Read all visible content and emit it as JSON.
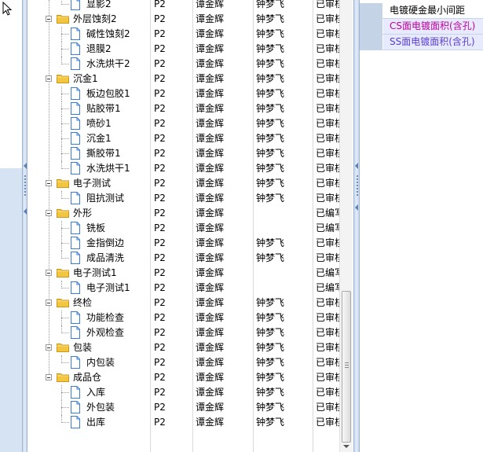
{
  "tree": {
    "rows": [
      {
        "level": 2,
        "type": "doc",
        "name": "显影2",
        "code": "P2",
        "person_a": "谭金辉",
        "person_b": "钟梦飞",
        "status": "已审核"
      },
      {
        "level": 1,
        "type": "folder",
        "name": "外层蚀刻2",
        "code": "P2",
        "person_a": "谭金辉",
        "person_b": "钟梦飞",
        "status": "已审核"
      },
      {
        "level": 2,
        "type": "doc",
        "name": "碱性蚀刻2",
        "code": "P2",
        "person_a": "谭金辉",
        "person_b": "钟梦飞",
        "status": "已审核"
      },
      {
        "level": 2,
        "type": "doc",
        "name": "退膜2",
        "code": "P2",
        "person_a": "谭金辉",
        "person_b": "钟梦飞",
        "status": "已审核"
      },
      {
        "level": 2,
        "type": "doc",
        "name": "水洗烘干2",
        "code": "P2",
        "person_a": "谭金辉",
        "person_b": "钟梦飞",
        "status": "已审核"
      },
      {
        "level": 1,
        "type": "folder",
        "name": "沉金1",
        "code": "P2",
        "person_a": "谭金辉",
        "person_b": "钟梦飞",
        "status": "已审核"
      },
      {
        "level": 2,
        "type": "doc",
        "name": "板边包胶1",
        "code": "P2",
        "person_a": "谭金辉",
        "person_b": "钟梦飞",
        "status": "已审核"
      },
      {
        "level": 2,
        "type": "doc",
        "name": "贴胶带1",
        "code": "P2",
        "person_a": "谭金辉",
        "person_b": "钟梦飞",
        "status": "已审核"
      },
      {
        "level": 2,
        "type": "doc",
        "name": "喷砂1",
        "code": "P2",
        "person_a": "谭金辉",
        "person_b": "钟梦飞",
        "status": "已审核"
      },
      {
        "level": 2,
        "type": "doc",
        "name": "沉金1",
        "code": "P2",
        "person_a": "谭金辉",
        "person_b": "钟梦飞",
        "status": "已审核"
      },
      {
        "level": 2,
        "type": "doc",
        "name": "撕胶带1",
        "code": "P2",
        "person_a": "谭金辉",
        "person_b": "钟梦飞",
        "status": "已审核"
      },
      {
        "level": 2,
        "type": "doc",
        "name": "水洗烘干1",
        "code": "P2",
        "person_a": "谭金辉",
        "person_b": "钟梦飞",
        "status": "已审核"
      },
      {
        "level": 1,
        "type": "folder",
        "name": "电子测试",
        "code": "P2",
        "person_a": "谭金辉",
        "person_b": "钟梦飞",
        "status": "已审核"
      },
      {
        "level": 2,
        "type": "doc",
        "name": "阻抗测试",
        "code": "P2",
        "person_a": "谭金辉",
        "person_b": "钟梦飞",
        "status": "已审核"
      },
      {
        "level": 1,
        "type": "folder",
        "name": "外形",
        "code": "P2",
        "person_a": "谭金辉",
        "person_b": "",
        "status": "已编写"
      },
      {
        "level": 2,
        "type": "doc",
        "name": "铣板",
        "code": "P2",
        "person_a": "谭金辉",
        "person_b": "",
        "status": "已编写"
      },
      {
        "level": 2,
        "type": "doc",
        "name": "金指倒边",
        "code": "P2",
        "person_a": "谭金辉",
        "person_b": "钟梦飞",
        "status": "已审核"
      },
      {
        "level": 2,
        "type": "doc",
        "name": "成品清洗",
        "code": "P2",
        "person_a": "谭金辉",
        "person_b": "钟梦飞",
        "status": "已审核"
      },
      {
        "level": 1,
        "type": "folder",
        "name": "电子测试1",
        "code": "P2",
        "person_a": "谭金辉",
        "person_b": "",
        "status": "已编写"
      },
      {
        "level": 2,
        "type": "doc",
        "name": "电子测试1",
        "code": "P2",
        "person_a": "谭金辉",
        "person_b": "",
        "status": "已编写"
      },
      {
        "level": 1,
        "type": "folder",
        "name": "终检",
        "code": "P2",
        "person_a": "谭金辉",
        "person_b": "钟梦飞",
        "status": "已审核"
      },
      {
        "level": 2,
        "type": "doc",
        "name": "功能检查",
        "code": "P2",
        "person_a": "谭金辉",
        "person_b": "钟梦飞",
        "status": "已审核"
      },
      {
        "level": 2,
        "type": "doc",
        "name": "外观检查",
        "code": "P2",
        "person_a": "谭金辉",
        "person_b": "钟梦飞",
        "status": "已审核"
      },
      {
        "level": 1,
        "type": "folder",
        "name": "包装",
        "code": "P2",
        "person_a": "谭金辉",
        "person_b": "钟梦飞",
        "status": "已审核"
      },
      {
        "level": 2,
        "type": "doc",
        "name": "内包装",
        "code": "P2",
        "person_a": "谭金辉",
        "person_b": "钟梦飞",
        "status": "已审核"
      },
      {
        "level": 1,
        "type": "folder",
        "name": "成品仓",
        "code": "P2",
        "person_a": "谭金辉",
        "person_b": "钟梦飞",
        "status": "已审核"
      },
      {
        "level": 2,
        "type": "doc",
        "name": "入库",
        "code": "P2",
        "person_a": "谭金辉",
        "person_b": "钟梦飞",
        "status": "已审核"
      },
      {
        "level": 2,
        "type": "doc",
        "name": "外包装",
        "code": "P2",
        "person_a": "谭金辉",
        "person_b": "钟梦飞",
        "status": "已审核"
      },
      {
        "level": 2,
        "type": "doc",
        "name": "出库",
        "code": "P2",
        "person_a": "谭金辉",
        "person_b": "钟梦飞",
        "status": "已审核"
      }
    ]
  },
  "right_panel": {
    "rows": [
      {
        "label": "电镀硬金最小间距",
        "style": "normal"
      },
      {
        "label": "CS面电镀面积(含孔)",
        "style": "pink"
      },
      {
        "label": "SS面电镀面积(含孔)",
        "style": "blue"
      }
    ]
  },
  "icons": {
    "folder": "folder-icon",
    "doc": "document-icon",
    "collapse": "collapse-toggle-icon",
    "cursor": "mouse-cursor-icon"
  },
  "colors": {
    "folder_yellow": "#f3c640",
    "doc_blue": "#3a7bd5",
    "panel_blue": "#d6e3f3",
    "pink_text": "#c000a0"
  }
}
